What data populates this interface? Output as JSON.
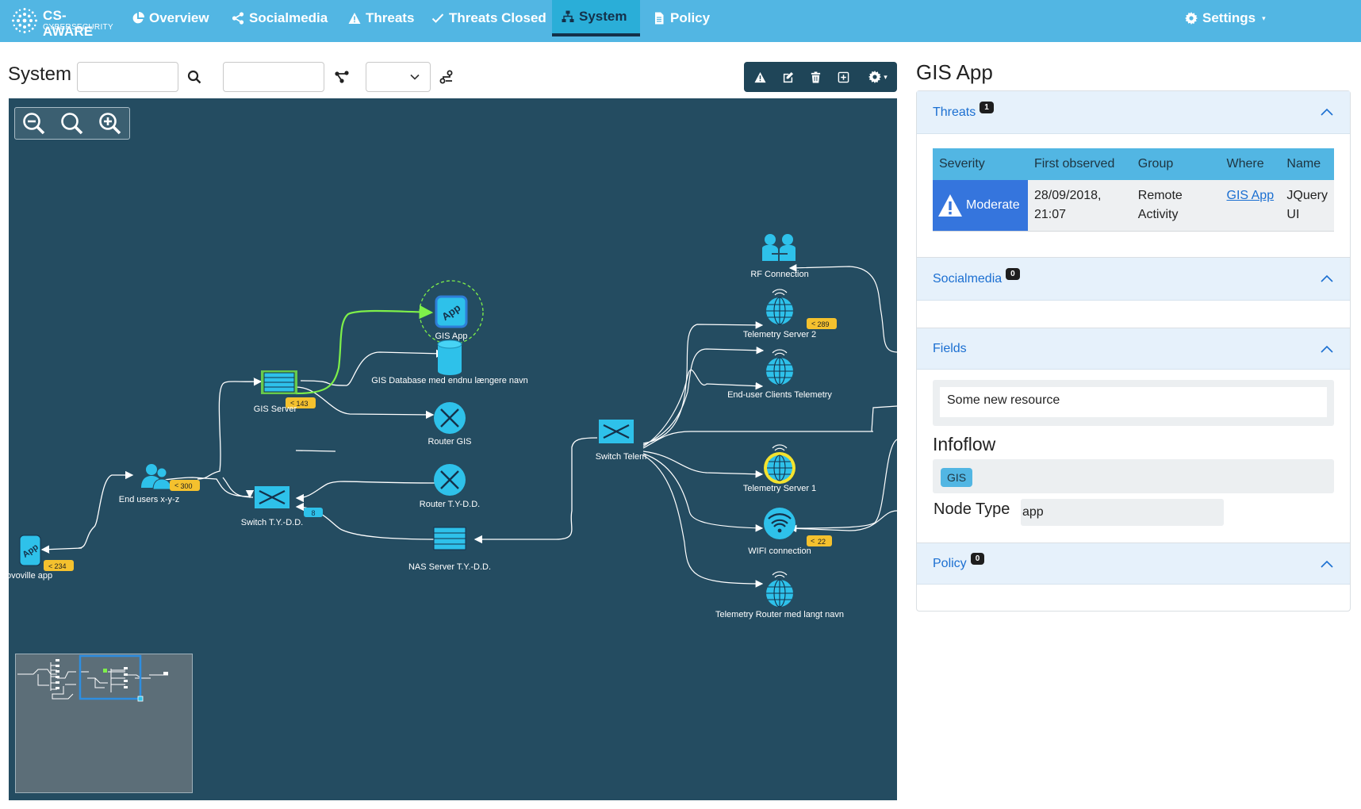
{
  "brand": {
    "name": "CS-AWARE",
    "tagline": "CYBERSECURITY"
  },
  "nav": {
    "items": [
      {
        "label": "Overview",
        "icon": "pie-chart-icon"
      },
      {
        "label": "Socialmedia",
        "icon": "share-icon"
      },
      {
        "label": "Threats",
        "icon": "warning-icon"
      },
      {
        "label": "Threats Closed",
        "icon": "check-icon"
      },
      {
        "label": "System",
        "icon": "sitemap-icon",
        "active": true
      },
      {
        "label": "Policy",
        "icon": "file-icon"
      }
    ],
    "settings_label": "Settings"
  },
  "toolbar": {
    "title": "System",
    "search_value": "",
    "path_value": "",
    "select_value": ""
  },
  "graph": {
    "nodes": [
      {
        "id": "gis-app",
        "label": "GIS App",
        "type": "app",
        "selected": true
      },
      {
        "id": "gis-db",
        "label": "GIS Database med endnu længere navn",
        "type": "database"
      },
      {
        "id": "gis-server",
        "label": "GIS Server",
        "type": "server",
        "badge": "143"
      },
      {
        "id": "router-gis",
        "label": "Router GIS",
        "type": "router"
      },
      {
        "id": "end-users",
        "label": "End users x-y-z",
        "type": "users",
        "badge": "300"
      },
      {
        "id": "switch-tydd",
        "label": "Switch T.Y.-D.D.",
        "type": "switch",
        "badge": "8"
      },
      {
        "id": "router-tydd",
        "label": "Router T.Y-D.D.",
        "type": "router"
      },
      {
        "id": "nas-server",
        "label": "NAS Server T.Y.-D.D.",
        "type": "server"
      },
      {
        "id": "ovoville-app",
        "label": "ovoville app",
        "type": "app",
        "badge": "234"
      },
      {
        "id": "switch-telem",
        "label": "Switch Telem",
        "type": "switch"
      },
      {
        "id": "rf-connection",
        "label": "RF Connection",
        "type": "handshake"
      },
      {
        "id": "telemetry-2",
        "label": "Telemetry Server 2",
        "type": "telemetry",
        "badge": "289"
      },
      {
        "id": "end-user-telemetry",
        "label": "End-user Clients Telemetry",
        "type": "telemetry"
      },
      {
        "id": "telemetry-1",
        "label": "Telemetry Server 1",
        "type": "telemetry",
        "threat": true
      },
      {
        "id": "wifi",
        "label": "WIFI connection",
        "type": "wifi",
        "badge": "22"
      },
      {
        "id": "telemetry-router",
        "label": "Telemetry Router med langt navn",
        "type": "telemetry"
      }
    ]
  },
  "detail": {
    "title": "GIS App",
    "threats": {
      "label": "Threats",
      "count": "1",
      "columns": [
        "Severity",
        "First observed",
        "Group",
        "Where",
        "Name"
      ],
      "rows": [
        {
          "severity": "Moderate",
          "first_observed": "28/09/2018, 21:07",
          "group": "Remote Activity",
          "where": "GIS App",
          "name": "JQuery UI"
        }
      ]
    },
    "socialmedia": {
      "label": "Socialmedia",
      "count": "0"
    },
    "fields": {
      "label": "Fields",
      "resource_value": "Some new resource",
      "infoflow_title": "Infoflow",
      "infoflow_tags": [
        "GIS"
      ],
      "node_type_label": "Node Type",
      "node_type_value": "app"
    },
    "policy": {
      "label": "Policy",
      "count": "0"
    }
  },
  "colors": {
    "navbar": "#52b6e3",
    "canvas": "#244c61",
    "node": "#2ec1ea",
    "badge": "#f4c12e",
    "selected_edge": "#7ef04a",
    "severity_moderate": "#3575dd",
    "link": "#1b6fd1"
  }
}
